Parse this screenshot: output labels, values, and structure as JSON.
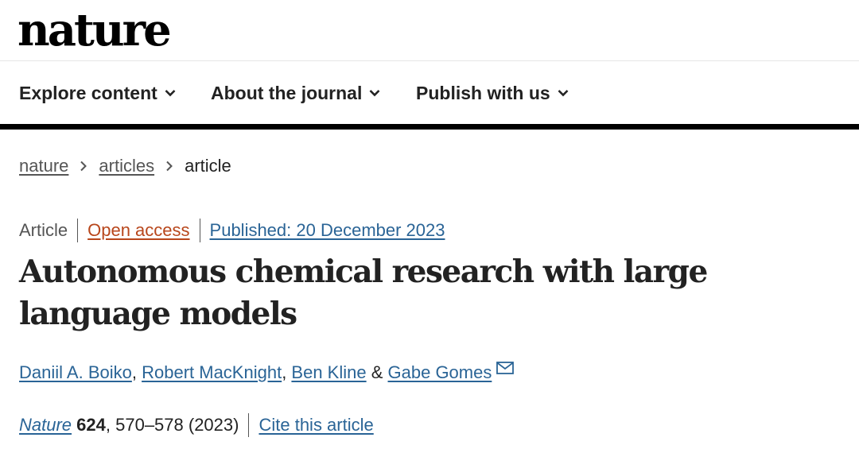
{
  "header": {
    "logo": "nature"
  },
  "nav": {
    "items": [
      {
        "label": "Explore content",
        "icon": "chevron-down-icon"
      },
      {
        "label": "About the journal",
        "icon": "chevron-down-icon"
      },
      {
        "label": "Publish with us",
        "icon": "chevron-down-icon"
      }
    ]
  },
  "breadcrumb": {
    "items": [
      "nature",
      "articles"
    ],
    "current": "article",
    "separator_icon": "chevron-right-icon"
  },
  "article": {
    "type": "Article",
    "access": "Open access",
    "published": "Published: 20 December 2023",
    "title": "Autonomous chemical research with large language models",
    "authors": [
      "Daniil A. Boiko",
      "Robert MacKnight",
      "Ben Kline",
      "Gabe Gomes"
    ],
    "author_separators": [
      ", ",
      ", ",
      " & "
    ],
    "corresponding_icon": "mail-icon",
    "journal": "Nature",
    "volume": "624",
    "pages_year": ", 570–578 (2023)",
    "cite_label": "Cite this article"
  },
  "colors": {
    "link": "#2a6496",
    "open_access": "#b8461b",
    "text": "#222222",
    "muted": "#555555"
  }
}
